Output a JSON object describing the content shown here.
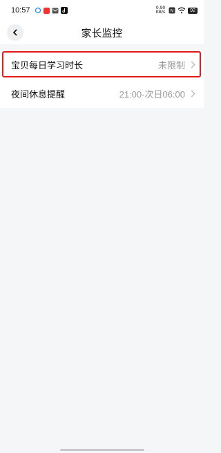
{
  "status_bar": {
    "time": "10:57",
    "net_speed_value": "0.90",
    "net_speed_unit": "KB/s",
    "battery": "92",
    "icons": [
      "cloud-icon",
      "red-app-icon",
      "mail-icon",
      "tiktok-icon",
      "nfc-icon",
      "wifi-icon",
      "battery-icon"
    ]
  },
  "header": {
    "title": "家长监控"
  },
  "settings": [
    {
      "label": "宝贝每日学习时长",
      "value": "未限制",
      "highlighted": true
    },
    {
      "label": "夜间休息提醒",
      "value": "21:00-次日06:00",
      "highlighted": false
    }
  ],
  "colors": {
    "highlight_border": "#e31b1b",
    "background": "#f5f6f8",
    "value_text": "#9a9a9a"
  }
}
